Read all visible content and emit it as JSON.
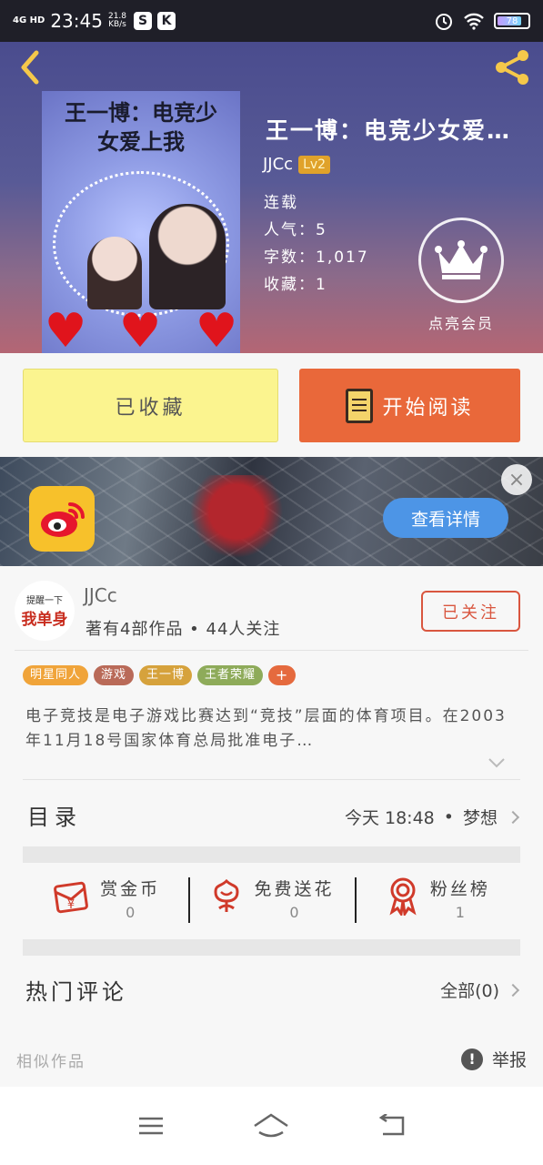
{
  "status_bar": {
    "network": "4G HD",
    "time": "23:45",
    "speed_value": "21.8",
    "speed_unit": "KB/s",
    "app1": "S",
    "app2": "K",
    "battery": "78"
  },
  "book": {
    "cover_title": "王一博：电竞少女爱上我",
    "title": "王一博：电竞少女爱…",
    "author": "JJCc",
    "author_level": "Lv2",
    "status": "连载",
    "popularity": "人气：5",
    "word_count": "字数：1,017",
    "favorites": "收藏：1",
    "vip_label": "点亮会员"
  },
  "actions": {
    "collected_label": "已收藏",
    "read_label": "开始阅读"
  },
  "ad": {
    "cta_label": "查看详情",
    "close_label": "×"
  },
  "author_card": {
    "avatar_line1": "提醒一下",
    "avatar_line2": "我单身",
    "name": "JJCc",
    "summary": "著有4部作品 • 44人关注",
    "follow_label": "已关注"
  },
  "tags": [
    {
      "label": "明星同人",
      "color": "#f0a43a"
    },
    {
      "label": "游戏",
      "color": "#b96a58"
    },
    {
      "label": "王一博",
      "color": "#d6a23c"
    },
    {
      "label": "王者荣耀",
      "color": "#8eab5a"
    },
    {
      "label": "+",
      "color": "#e56a3e"
    }
  ],
  "description": "电子竞技是电子游戏比赛达到“竞技”层面的体育项目。在2003年11月18号国家体育总局批准电子…",
  "toc": {
    "title": "目录",
    "update_time": "今天  18:48",
    "separator": "•",
    "latest_chapter": "梦想"
  },
  "stats": [
    {
      "label": "赏金币",
      "value": "0",
      "icon": "red-envelope-icon"
    },
    {
      "label": "免费送花",
      "value": "0",
      "icon": "flower-icon"
    },
    {
      "label": "粉丝榜",
      "value": "1",
      "icon": "medal-icon"
    }
  ],
  "comments": {
    "title": "热门评论",
    "all_label": "全部(0)"
  },
  "footer": {
    "similar_label": "相似作品",
    "report_label": "举报",
    "report_icon": "!"
  },
  "colors": {
    "accent": "#e9683a",
    "collected_bg": "#fbf48f",
    "follow": "#d9563f",
    "ad_button": "#4d95e6"
  }
}
